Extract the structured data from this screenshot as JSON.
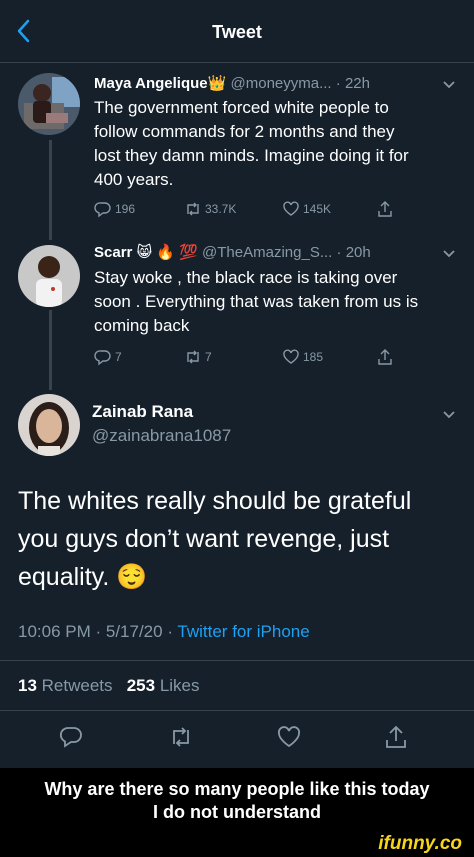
{
  "header": {
    "title": "Tweet"
  },
  "thread": [
    {
      "name": "Maya Angelique",
      "emoji": "👑",
      "handle": "@moneyyma...",
      "time": "22h",
      "text_lines": [
        "The government forced white people to",
        "follow commands for 2 months and they",
        "lost they damn minds. Imagine doing it for",
        "400 years."
      ],
      "replies": "196",
      "retweets": "33.7K",
      "likes": "145K"
    },
    {
      "name": "Scarr",
      "emoji": "😸 🔥 💯",
      "handle": "@TheAmazing_S...",
      "time": "20h",
      "text_lines": [
        "Stay woke , the black race is taking over",
        "soon . Everything that was taken from us is",
        "coming back"
      ],
      "replies": "7",
      "retweets": "7",
      "likes": "185"
    }
  ],
  "main": {
    "name": "Zainab Rana",
    "handle": "@zainabrana1087",
    "text_lines": [
      "The whites really should be grateful",
      "you guys don’t want revenge, just",
      "equality. 😌"
    ],
    "timestamp": "10:06 PM · 5/17/20 · ",
    "source": "Twitter for iPhone",
    "retweet_count": "13",
    "retweet_label": "Retweets",
    "like_count": "253",
    "like_label": "Likes"
  },
  "caption": {
    "line1": "Why are there so many people like this today",
    "line2": "I do not understand"
  },
  "watermark": "ifunny.co",
  "icons": [
    "back-arrow-icon",
    "chevron-down-icon",
    "reply-icon",
    "retweet-icon",
    "like-icon",
    "share-icon"
  ],
  "colors": {
    "background": "#15202b",
    "accent": "#1da1f2",
    "muted": "#8899a6",
    "watermark": "#f7d51d"
  }
}
